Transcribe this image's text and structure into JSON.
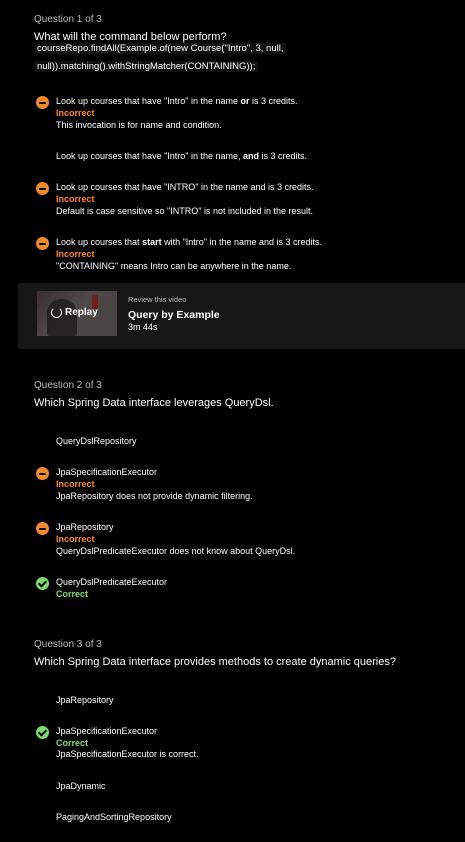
{
  "q1": {
    "number": "Question 1 of 3",
    "question": "What will the command below perform?",
    "code_line1": "courseRepo.findAll(Example.of(new Course(\"Intro\", 3, null,",
    "code_line2": "null)).matching().withStringMatcher(CONTAINING));",
    "options": [
      {
        "pre": "Look up courses that have \"Intro\" in the name ",
        "bold": "or",
        "post": " is 3 credits.",
        "status": "incorrect",
        "verdict": "Incorrect",
        "explanation": "This invocation is for name and condition."
      },
      {
        "pre": "Look up courses that have \"Intro\" in the name, ",
        "bold": "and",
        "post": " is 3 credits.",
        "status": "none"
      },
      {
        "pre": "Look up courses that have \"INTRO\" in the name and is 3 credits.",
        "bold": "",
        "post": "",
        "status": "incorrect",
        "verdict": "Incorrect",
        "explanation": "Default is case sensitive so \"INTRO\" is not included in the result."
      },
      {
        "pre": "Look up courses that ",
        "bold": "start",
        "post": " with \"Intro\" in the name and is 3 credits.",
        "status": "incorrect",
        "verdict": "Incorrect",
        "explanation": "\"CONTAINING\" means Intro can be anywhere in the name."
      }
    ]
  },
  "video": {
    "replay_label": "Replay",
    "subtitle": "Review this video",
    "title": "Query by Example",
    "duration": "3m 44s"
  },
  "q2": {
    "number": "Question 2 of 3",
    "question": "Which Spring Data interface leverages QueryDsl.",
    "options": [
      {
        "label": "QueryDslRepository",
        "status": "none"
      },
      {
        "label": "JpaSpecificationExecutor",
        "status": "incorrect",
        "verdict": "Incorrect",
        "explanation": "JpaRepository does not provide dynamic filtering."
      },
      {
        "label": "JpaRepository",
        "status": "incorrect",
        "verdict": "Incorrect",
        "explanation": "QueryDslPredicateExecutor does not know about QueryDsl."
      },
      {
        "label": "QueryDslPredicateExecutor",
        "status": "correct",
        "verdict": "Correct"
      }
    ]
  },
  "q3": {
    "number": "Question 3 of 3",
    "question": "Which Spring Data interface provides methods to create dynamic queries?",
    "options": [
      {
        "label": "JpaRepository",
        "status": "none"
      },
      {
        "label": "JpaSpecificationExecutor",
        "status": "correct",
        "verdict": "Correct",
        "explanation": "JpaSpecificationExecutor is correct."
      },
      {
        "label": "JpaDynamic",
        "status": "none"
      },
      {
        "label": "PagingAndSortingRepository",
        "status": "none"
      }
    ]
  },
  "colors": {
    "incorrect": "#f28a2d",
    "correct": "#7bdc6a",
    "background": "#000000"
  }
}
